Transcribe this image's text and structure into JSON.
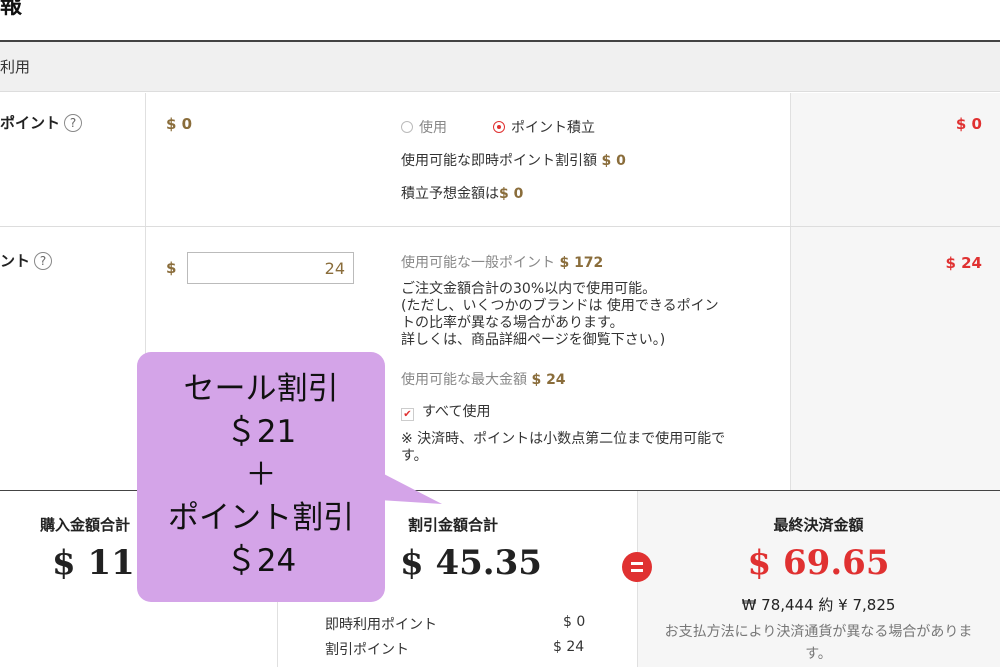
{
  "header": {
    "title": "報"
  },
  "section": {
    "label": "利用"
  },
  "rows": {
    "instant": {
      "label": "ポイント",
      "help": "?",
      "amount": "$ 0",
      "radio_use": "使用",
      "radio_save": "ポイント積立",
      "avail_label": "使用可能な即時ポイント割引額",
      "avail_value": "$ 0",
      "expected_label": "積立予想金額は",
      "expected_value": "$ 0",
      "result": "$ 0"
    },
    "general": {
      "label": "ント",
      "help": "?",
      "currency": "$",
      "input_value": "24",
      "avail_label": "使用可能な一般ポイント",
      "avail_value": "$ 172",
      "note1": "ご注文金額合計の30%以内で使用可能。",
      "note2": "(ただし、いくつかのブランドは 使用できるポイン",
      "note3": "トの比率が異なる場合があります。",
      "note4": "詳しくは、商品詳細ページを御覧下さい。)",
      "max_label": "使用可能な最大金額",
      "max_value": "$ 24",
      "use_all": "すべて使用",
      "decimal_note1": "※ 決済時、ポイントは小数点第二位まで使用可能で",
      "decimal_note2": "す。",
      "result": "$ 24"
    }
  },
  "summary": {
    "purchase_label": "購入金額合計",
    "purchase_value": "$ 115",
    "discount_label": "割引金額合計",
    "discount_value": "$ 45.35",
    "instant_label": "即時利用ポイント",
    "instant_value": "$ 0",
    "discount_point_label": "割引ポイント",
    "discount_point_value": "$ 24",
    "final_label": "最終決済金額",
    "final_value": "$ 69.65",
    "final_other": "₩ 78,444 約 ¥ 7,825",
    "final_note1": "お支払方法により決済通貨が異なる場合がありま",
    "final_note2": "す。"
  },
  "callout": {
    "line1": "セール割引",
    "line2": "＄21",
    "line3": "＋",
    "line4": "ポイント割引",
    "line5": "＄24"
  },
  "colors": {
    "accent_red": "#e03131",
    "gold": "#8a6d3b",
    "callout": "#d4a4e8"
  }
}
